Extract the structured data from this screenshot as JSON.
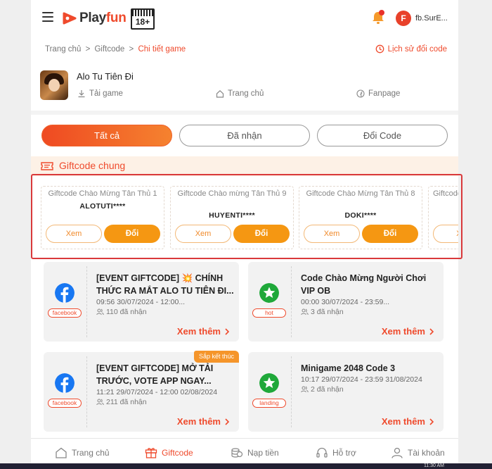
{
  "header": {
    "logo_prefix": "Play",
    "logo_suffix": "fun",
    "age_rating": "18+",
    "user_initial": "F",
    "username": "fb.SurE..."
  },
  "breadcrumb": {
    "home": "Trang chủ",
    "giftcode": "Giftcode",
    "current": "Chi tiết game",
    "separator": ">"
  },
  "history_link": "Lịch sử đổi code",
  "game": {
    "title": "Alo Tu Tiên Đi",
    "links": {
      "download": "Tải game",
      "homepage": "Trang chủ",
      "fanpage": "Fanpage"
    }
  },
  "tabs": [
    "Tất cả",
    "Đã nhận",
    "Đổi Code"
  ],
  "section_title": "Giftcode chung",
  "giftcodes": [
    {
      "title": "Giftcode Chào Mừng Tân Thủ 1",
      "code": "ALOTUTI****"
    },
    {
      "title": "Giftcode Chào mừng Tân Thủ 9",
      "code": "HUYENTI****"
    },
    {
      "title": "Giftcode Chào Mừng Tân Thủ 8",
      "code": "DOKI****"
    },
    {
      "title": "Giftcode",
      "code": ""
    }
  ],
  "card_buttons": {
    "view": "Xem",
    "redeem": "Đổi",
    "view_partial": "Xe"
  },
  "events": [
    {
      "title": "[EVENT GIFTCODE] 💥 CHÍNH THỨC RA MẮT ALO TU TIÊN ĐI...",
      "date": "09:56 30/07/2024 - 12:00...",
      "count": "110 đã nhận",
      "tag": "facebook",
      "icon": "facebook-icon",
      "ribbon": ""
    },
    {
      "title": "Code Chào Mừng Người Chơi VIP OB",
      "date": "00:00 30/07/2024 - 23:59...",
      "count": "3 đã nhận",
      "tag": "hot",
      "icon": "star-icon",
      "ribbon": ""
    },
    {
      "title": "[EVENT GIFTCODE] MỞ TẢI TRƯỚC, VOTE APP NGAY...",
      "date": "11:21 29/07/2024 - 12:00 02/08/2024",
      "count": "211 đã nhận",
      "tag": "facebook",
      "icon": "facebook-icon",
      "ribbon": "Sắp kết thúc"
    },
    {
      "title": "Minigame 2048 Code 3",
      "date": "10:17 29/07/2024 - 23:59 31/08/2024",
      "count": "2 đã nhận",
      "tag": "landing",
      "icon": "star-icon",
      "ribbon": ""
    }
  ],
  "see_more": "Xem thêm",
  "bottom_nav": [
    "Trang chủ",
    "Giftcode",
    "Nạp tiền",
    "Hỗ trợ",
    "Tài khoản"
  ],
  "clock": "11:30 AM",
  "colors": {
    "brand": "#ef4a2c",
    "accent_orange": "#f59712",
    "highlight_border": "#d9393b",
    "facebook": "#1877f2",
    "star_green": "#1fa83a"
  }
}
